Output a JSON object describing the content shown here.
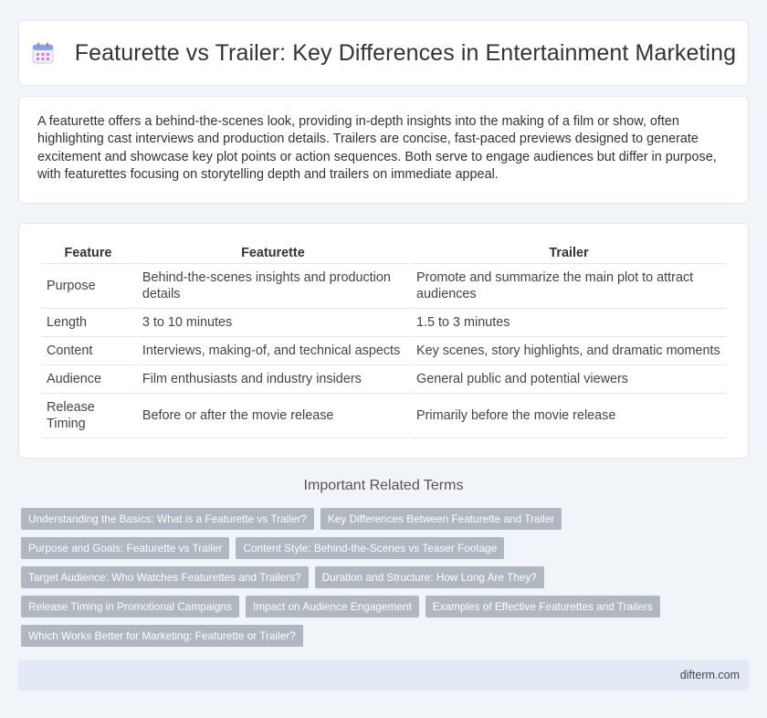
{
  "header": {
    "title": "Featurette vs Trailer: Key Differences in Entertainment Marketing",
    "icon": "calendar-icon"
  },
  "intro": {
    "text": "A featurette offers a behind-the-scenes look, providing in-depth insights into the making of a film or show, often highlighting cast interviews and production details. Trailers are concise, fast-paced previews designed to generate excitement and showcase key plot points or action sequences. Both serve to engage audiences but differ in purpose, with featurettes focusing on storytelling depth and trailers on immediate appeal."
  },
  "table": {
    "headers": [
      "Feature",
      "Featurette",
      "Trailer"
    ],
    "rows": [
      [
        "Purpose",
        "Behind-the-scenes insights and production details",
        "Promote and summarize the main plot to attract audiences"
      ],
      [
        "Length",
        "3 to 10 minutes",
        "1.5 to 3 minutes"
      ],
      [
        "Content",
        "Interviews, making-of, and technical aspects",
        "Key scenes, story highlights, and dramatic moments"
      ],
      [
        "Audience",
        "Film enthusiasts and industry insiders",
        "General public and potential viewers"
      ],
      [
        "Release Timing",
        "Before or after the movie release",
        "Primarily before the movie release"
      ]
    ]
  },
  "related": {
    "title": "Important Related Terms",
    "rows": [
      [
        "Understanding the Basics: What is a Featurette vs Trailer?",
        "Key Differences Between Featurette and Trailer"
      ],
      [
        "Purpose and Goals: Featurette vs Trailer",
        "Content Style: Behind-the-Scenes vs Teaser Footage"
      ],
      [
        "Target Audience: Who Watches Featurettes and Trailers?",
        "Duration and Structure: How Long Are They?"
      ],
      [
        "Release Timing in Promotional Campaigns",
        "Impact on Audience Engagement",
        "Examples of Effective Featurettes and Trailers"
      ],
      [
        "Which Works Better for Marketing: Featurette or Trailer?"
      ]
    ]
  },
  "footer": {
    "site": "difterm.com"
  }
}
